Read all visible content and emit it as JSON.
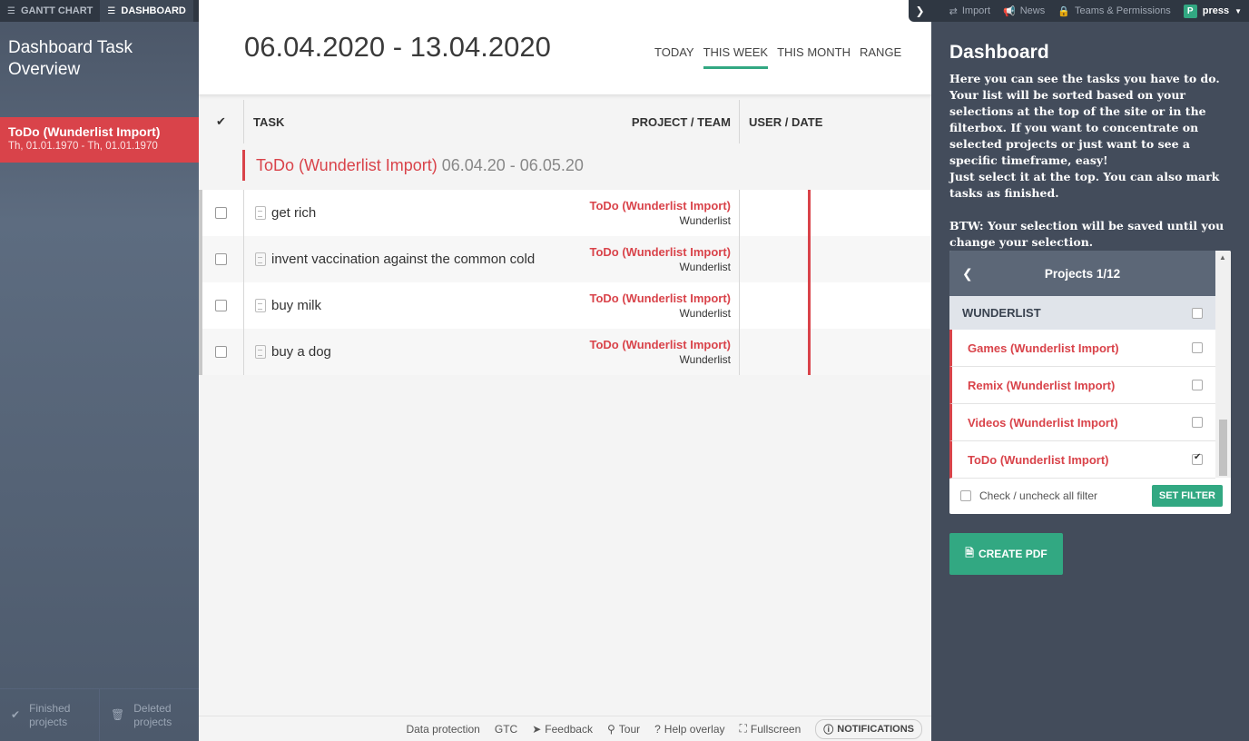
{
  "nav": {
    "tabs": [
      {
        "label": "GANTT CHART",
        "icon": "gantt-icon",
        "active": false
      },
      {
        "label": "DASHBOARD",
        "icon": "dashboard-list-icon",
        "active": true
      }
    ]
  },
  "sidebar": {
    "title": "Dashboard Task Overview",
    "items": [
      {
        "title": "ToDo (Wunderlist Import)",
        "dates": "Th, 01.01.1970 - Th, 01.01.1970"
      }
    ],
    "bottom": {
      "finished": "Finished projects",
      "deleted": "Deleted projects"
    }
  },
  "header": {
    "date_range": "06.04.2020 - 13.04.2020",
    "views": [
      "TODAY",
      "THIS WEEK",
      "THIS MONTH",
      "RANGE"
    ],
    "active_view": "THIS WEEK"
  },
  "table": {
    "columns": {
      "check": "✔",
      "task": "TASK",
      "project": "PROJECT / TEAM",
      "user": "USER / DATE"
    },
    "group": {
      "name": "ToDo (Wunderlist Import)",
      "range": "06.04.20 - 06.05.20"
    },
    "rows": [
      {
        "task": "get rich",
        "project": "ToDo (Wunderlist Import)",
        "team": "Wunderlist"
      },
      {
        "task": "invent vaccination against the common cold",
        "project": "ToDo (Wunderlist Import)",
        "team": "Wunderlist"
      },
      {
        "task": "buy milk",
        "project": "ToDo (Wunderlist Import)",
        "team": "Wunderlist"
      },
      {
        "task": "buy a dog",
        "project": "ToDo (Wunderlist Import)",
        "team": "Wunderlist"
      }
    ]
  },
  "footer": {
    "data_protection": "Data protection",
    "gtc": "GTC",
    "feedback": "Feedback",
    "tour": "Tour",
    "help": "Help overlay",
    "fullscreen": "Fullscreen",
    "notifications": "NOTIFICATIONS"
  },
  "topbar_right": {
    "import": "Import",
    "news": "News",
    "teams": "Teams & Permissions",
    "avatar": "P",
    "user": "press"
  },
  "panel": {
    "title": "Dashboard",
    "description_1": "Here you can see the tasks you have to do. Your list will be sorted based on your selections at the top of the site or in the filterbox. If you want to concentrate on selected projects or just want to see a specific timeframe, easy!",
    "description_2": "Just select it at the top. You can also mark tasks as finished.",
    "description_3": "BTW: Your selection will be saved until you change your selection.",
    "filter": {
      "title": "Projects 1/12",
      "group": "WUNDERLIST",
      "items": [
        {
          "label": "Games (Wunderlist Import)",
          "checked": false
        },
        {
          "label": "Remix (Wunderlist Import)",
          "checked": false
        },
        {
          "label": "Videos (Wunderlist Import)",
          "checked": false
        },
        {
          "label": "ToDo (Wunderlist Import)",
          "checked": true
        }
      ],
      "check_all": "Check / uncheck all filter",
      "set_filter": "SET FILTER"
    },
    "create_pdf": "CREATE PDF"
  },
  "colors": {
    "accent": "#32a882",
    "project_red": "#d9434a",
    "sidebar": "#4d5a6c",
    "panel": "#434c5b"
  }
}
